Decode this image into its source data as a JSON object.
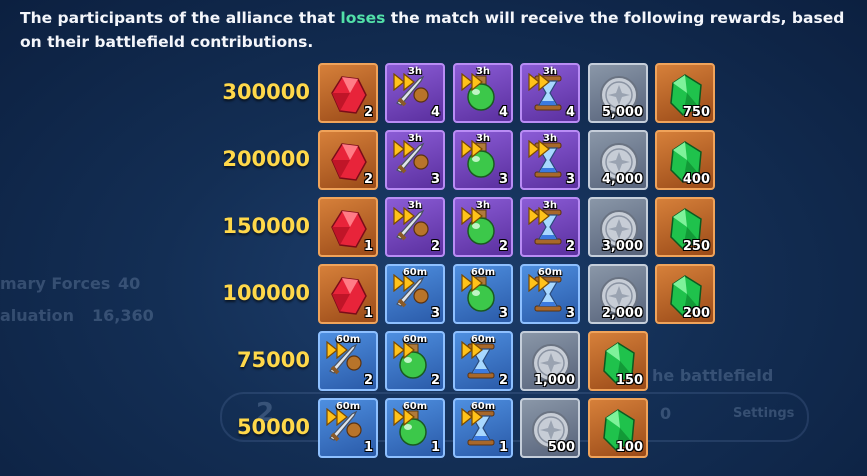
{
  "description": {
    "prefix": "The participants of the alliance that ",
    "highlight": "loses",
    "suffix": " the match will receive the following rewards, based on their battlefield contributions."
  },
  "background": {
    "text1": "mary Forces",
    "num1": "40",
    "text2": "aluation",
    "num2": "16,360",
    "text3": "he battlefield",
    "digit_left": "2",
    "digit_right": "0",
    "settings": "Settings"
  },
  "tiers": [
    {
      "score": "300000",
      "rewards": [
        {
          "item": "red-gem",
          "tile": "orange",
          "qty": "2"
        },
        {
          "item": "sword-speedup",
          "tile": "purple",
          "duration": "3h",
          "qty": "4"
        },
        {
          "item": "potion-speedup",
          "tile": "purple",
          "duration": "3h",
          "qty": "4"
        },
        {
          "item": "hourglass-speedup",
          "tile": "purple",
          "duration": "3h",
          "qty": "4"
        },
        {
          "item": "silver-coin",
          "tile": "gray",
          "qty": "5,000"
        },
        {
          "item": "green-gem",
          "tile": "orange",
          "qty": "750"
        }
      ]
    },
    {
      "score": "200000",
      "rewards": [
        {
          "item": "red-gem",
          "tile": "orange",
          "qty": "2"
        },
        {
          "item": "sword-speedup",
          "tile": "purple",
          "duration": "3h",
          "qty": "3"
        },
        {
          "item": "potion-speedup",
          "tile": "purple",
          "duration": "3h",
          "qty": "3"
        },
        {
          "item": "hourglass-speedup",
          "tile": "purple",
          "duration": "3h",
          "qty": "3"
        },
        {
          "item": "silver-coin",
          "tile": "gray",
          "qty": "4,000"
        },
        {
          "item": "green-gem",
          "tile": "orange",
          "qty": "400"
        }
      ]
    },
    {
      "score": "150000",
      "rewards": [
        {
          "item": "red-gem",
          "tile": "orange",
          "qty": "1"
        },
        {
          "item": "sword-speedup",
          "tile": "purple",
          "duration": "3h",
          "qty": "2"
        },
        {
          "item": "potion-speedup",
          "tile": "purple",
          "duration": "3h",
          "qty": "2"
        },
        {
          "item": "hourglass-speedup",
          "tile": "purple",
          "duration": "3h",
          "qty": "2"
        },
        {
          "item": "silver-coin",
          "tile": "gray",
          "qty": "3,000"
        },
        {
          "item": "green-gem",
          "tile": "orange",
          "qty": "250"
        }
      ]
    },
    {
      "score": "100000",
      "rewards": [
        {
          "item": "red-gem",
          "tile": "orange",
          "qty": "1"
        },
        {
          "item": "sword-speedup",
          "tile": "blue",
          "duration": "60m",
          "qty": "3"
        },
        {
          "item": "potion-speedup",
          "tile": "blue",
          "duration": "60m",
          "qty": "3"
        },
        {
          "item": "hourglass-speedup",
          "tile": "blue",
          "duration": "60m",
          "qty": "3"
        },
        {
          "item": "silver-coin",
          "tile": "gray",
          "qty": "2,000"
        },
        {
          "item": "green-gem",
          "tile": "orange",
          "qty": "200"
        }
      ]
    },
    {
      "score": "75000",
      "rewards": [
        {
          "item": "sword-speedup",
          "tile": "blue",
          "duration": "60m",
          "qty": "2"
        },
        {
          "item": "potion-speedup",
          "tile": "blue",
          "duration": "60m",
          "qty": "2"
        },
        {
          "item": "hourglass-speedup",
          "tile": "blue",
          "duration": "60m",
          "qty": "2"
        },
        {
          "item": "silver-coin",
          "tile": "gray",
          "qty": "1,000"
        },
        {
          "item": "green-gem",
          "tile": "orange",
          "qty": "150"
        }
      ]
    },
    {
      "score": "50000",
      "rewards": [
        {
          "item": "sword-speedup",
          "tile": "blue",
          "duration": "60m",
          "qty": "1"
        },
        {
          "item": "potion-speedup",
          "tile": "blue",
          "duration": "60m",
          "qty": "1"
        },
        {
          "item": "hourglass-speedup",
          "tile": "blue",
          "duration": "60m",
          "qty": "1"
        },
        {
          "item": "silver-coin",
          "tile": "gray",
          "qty": "500"
        },
        {
          "item": "green-gem",
          "tile": "orange",
          "qty": "100"
        }
      ]
    }
  ]
}
